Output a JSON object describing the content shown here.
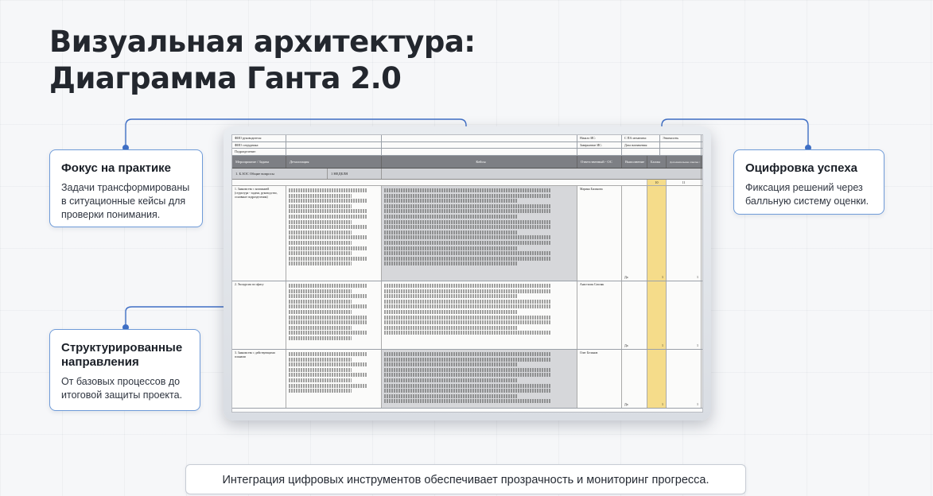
{
  "title": {
    "line1": "Визуальная архитектура:",
    "line2": "Диаграмма Ганта 2.0"
  },
  "callouts": {
    "practice": {
      "heading": "Фокус на практике",
      "text": "Задачи трансформированы в ситуационные кейсы для проверки понимания."
    },
    "structured": {
      "heading": "Структурированные направления",
      "text": "От базовых процессов до итоговой защиты проекта."
    },
    "digital": {
      "heading": "Оцифровка успеха",
      "text": "Фиксация решений через балльную систему оценки."
    }
  },
  "spreadsheet": {
    "meta_left": [
      "ФИО руководителя:",
      "ФИО сотрудника:",
      "Подразделение:"
    ],
    "meta_right": [
      "Начало ИС:",
      "С ПА механизм:",
      "Завершение ИС:",
      "Дата назначения:"
    ],
    "meta_far_right": "Этапность",
    "columns": [
      "Мероприятие / Задача",
      "Детализация",
      "Кейсы",
      "Ответственный - ОС",
      "Выполнение",
      "Баллы",
      "Дополнительная отметка / Комментарий"
    ],
    "subheader": [
      "1. Б.ЗОС Общие вопросы",
      "1 НЕДЕЛЯ"
    ],
    "week_numbers": [
      "10",
      "11"
    ],
    "rows": [
      {
        "task": "1. Знакомство с компанией (структура - задачи, руководство, основные подразделения)",
        "owner": "Марина Басинова",
        "done": "Да",
        "score": "1",
        "extra": "1"
      },
      {
        "task": "2. Экскурсия по офису",
        "owner": "Анастасия Смоляк",
        "done": "Да",
        "score": "1",
        "extra": "1"
      },
      {
        "task": "3. Знакомство с действующими планами",
        "owner": "Олег Белинов",
        "done": "Да",
        "score": "1",
        "extra": "1"
      }
    ]
  },
  "caption": "Интеграция цифровых инструментов обеспечивает прозрачность и мониторинг прогресса.",
  "colors": {
    "accent": "#3f6fc5",
    "card_border": "#6f9bd8",
    "sheet_header": "#7d7f84",
    "score_column": "#f5dc8a"
  }
}
